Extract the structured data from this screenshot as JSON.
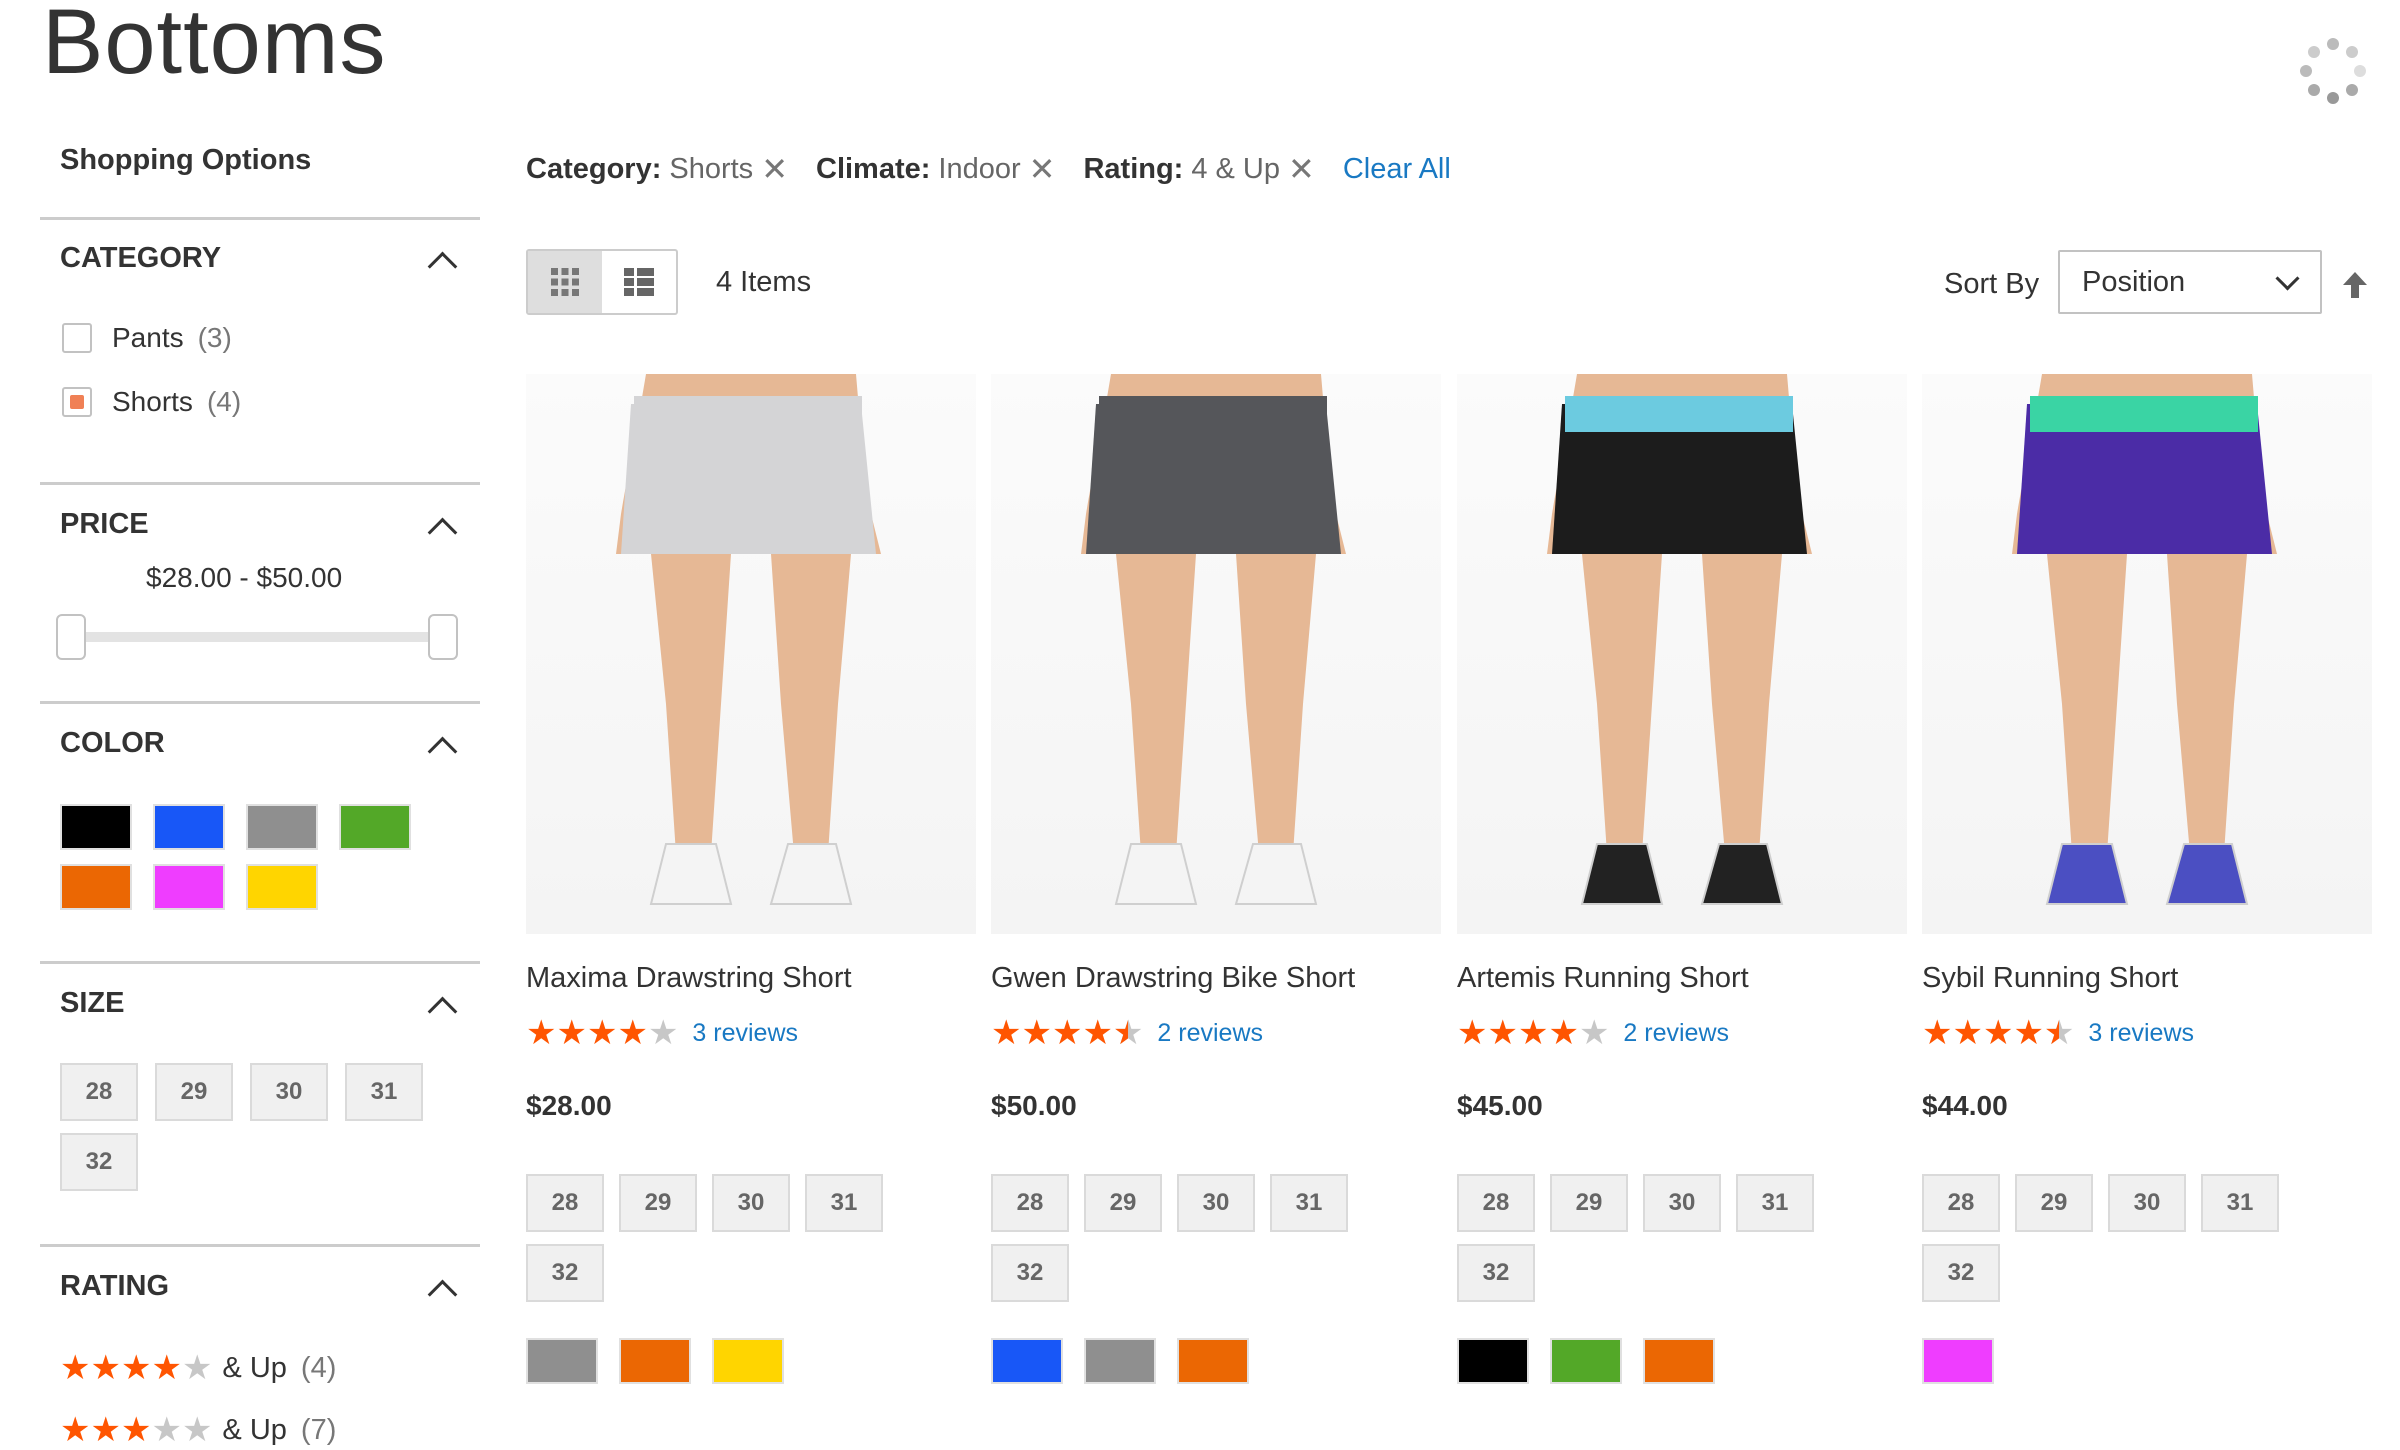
{
  "page": {
    "title": "Bottoms"
  },
  "sidebar": {
    "heading": "Shopping Options",
    "category": {
      "title": "CATEGORY",
      "items": [
        {
          "label": "Pants",
          "count": "(3)",
          "checked": false
        },
        {
          "label": "Shorts",
          "count": "(4)",
          "checked": true
        }
      ]
    },
    "price": {
      "title": "PRICE",
      "range": "$28.00 - $50.00"
    },
    "color": {
      "title": "COLOR",
      "swatches": [
        "#000000",
        "#1857f7",
        "#8f8f8f",
        "#53a828",
        "#eb6703",
        "#ef3dff",
        "#ffd500"
      ]
    },
    "size": {
      "title": "SIZE",
      "options": [
        "28",
        "29",
        "30",
        "31",
        "32"
      ]
    },
    "rating": {
      "title": "RATING",
      "rows": [
        {
          "stars": 4,
          "label": "& Up",
          "count": "(4)"
        },
        {
          "stars": 3,
          "label": "& Up",
          "count": "(7)"
        }
      ]
    }
  },
  "filters": {
    "active": [
      {
        "label": "Category:",
        "value": "Shorts"
      },
      {
        "label": "Climate:",
        "value": "Indoor"
      },
      {
        "label": "Rating:",
        "value": "4 & Up"
      }
    ],
    "clear_all": "Clear All"
  },
  "toolbar": {
    "items_count": "4 Items",
    "sort_label": "Sort By",
    "sort_value": "Position"
  },
  "products": [
    {
      "name": "Maxima Drawstring Short",
      "rating": 4,
      "reviews": "3 reviews",
      "price": "$28.00",
      "sizes": [
        "28",
        "29",
        "30",
        "31",
        "32"
      ],
      "colors": [
        "#8f8f8f",
        "#eb6703",
        "#ffd500"
      ],
      "short_color": "#d4d4d6",
      "band_color": "#d4d4d6",
      "shoe_color": "#f4f4f4"
    },
    {
      "name": "Gwen Drawstring Bike Short",
      "rating": 4.5,
      "reviews": "2 reviews",
      "price": "$50.00",
      "sizes": [
        "28",
        "29",
        "30",
        "31",
        "32"
      ],
      "colors": [
        "#1857f7",
        "#8f8f8f",
        "#eb6703"
      ],
      "short_color": "#55565a",
      "band_color": "#55565a",
      "shoe_color": "#f4f4f4"
    },
    {
      "name": "Artemis Running Short",
      "rating": 4,
      "reviews": "2 reviews",
      "price": "$45.00",
      "sizes": [
        "28",
        "29",
        "30",
        "31",
        "32"
      ],
      "colors": [
        "#000000",
        "#53a828",
        "#eb6703"
      ],
      "short_color": "#1c1c1c",
      "band_color": "#6ccbe0",
      "shoe_color": "#222222"
    },
    {
      "name": "Sybil Running Short",
      "rating": 4.5,
      "reviews": "3 reviews",
      "price": "$44.00",
      "sizes": [
        "28",
        "29",
        "30",
        "31",
        "32"
      ],
      "colors": [
        "#ef3dff"
      ],
      "short_color": "#4b2ca6",
      "band_color": "#3ad4a4",
      "shoe_color": "#4b4fc2"
    }
  ]
}
